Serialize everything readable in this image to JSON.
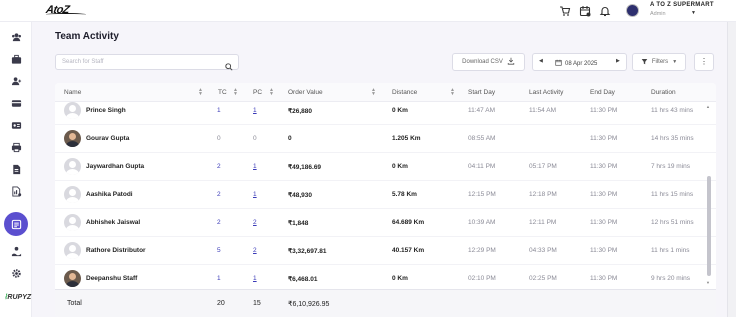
{
  "topbar": {
    "logo_text": "AtoZ",
    "store_name": "A TO Z SUPERMART",
    "user_role": "Admin",
    "icons": [
      "cart-icon",
      "calendar-check-icon",
      "bell-icon"
    ]
  },
  "sidebar": {
    "brand": "RUPYZ",
    "items": [
      "team-icon",
      "briefcase-icon",
      "user-add-icon",
      "card-icon",
      "id-card-icon",
      "print-icon",
      "document-icon",
      "chart-doc-icon",
      "team-activity-icon",
      "hand-user-icon",
      "settings-icon"
    ],
    "active_item": "team-activity-icon",
    "accent_color": "#5b4fcf"
  },
  "page": {
    "title": "Team Activity"
  },
  "toolbar": {
    "search_placeholder": "Search for Staff",
    "download_label": "Download CSV",
    "date": "08 Apr 2025",
    "filters_label": "Filters"
  },
  "table": {
    "columns": [
      "Name",
      "TC",
      "PC",
      "Order Value",
      "Distance",
      "Start Day",
      "Last Activity",
      "End Day",
      "Duration"
    ],
    "rows": [
      {
        "name": "Prince Singh",
        "tc": "1",
        "pc": "1",
        "order_value": "₹26,880",
        "distance": "0 Km",
        "start_day": "11:47 AM",
        "last_activity": "11:54 AM",
        "end_day": "11:30 PM",
        "duration": "11 hrs 43 mins",
        "photo": false
      },
      {
        "name": "Gourav Gupta",
        "tc": "0",
        "pc": "0",
        "order_value": "0",
        "distance": "1.205 Km",
        "start_day": "08:55 AM",
        "last_activity": "",
        "end_day": "11:30 PM",
        "duration": "14 hrs 35 mins",
        "photo": true
      },
      {
        "name": "Jaywardhan Gupta",
        "tc": "2",
        "pc": "1",
        "order_value": "₹49,186.69",
        "distance": "0 Km",
        "start_day": "04:11 PM",
        "last_activity": "05:17 PM",
        "end_day": "11:30 PM",
        "duration": "7 hrs 19 mins",
        "photo": false
      },
      {
        "name": "Aashika Patodi",
        "tc": "2",
        "pc": "1",
        "order_value": "₹48,930",
        "distance": "5.78 Km",
        "start_day": "12:15 PM",
        "last_activity": "12:18 PM",
        "end_day": "11:30 PM",
        "duration": "11 hrs 15 mins",
        "photo": false
      },
      {
        "name": "Abhishek Jaiswal",
        "tc": "2",
        "pc": "2",
        "order_value": "₹1,848",
        "distance": "64.689 Km",
        "start_day": "10:39 AM",
        "last_activity": "12:11 PM",
        "end_day": "11:30 PM",
        "duration": "12 hrs 51 mins",
        "photo": false
      },
      {
        "name": "Rathore Distributor",
        "tc": "5",
        "pc": "2",
        "order_value": "₹3,32,697.81",
        "distance": "40.157 Km",
        "start_day": "12:29 PM",
        "last_activity": "04:33 PM",
        "end_day": "11:30 PM",
        "duration": "11 hrs 1 mins",
        "photo": false
      },
      {
        "name": "Deepanshu Staff",
        "tc": "1",
        "pc": "1",
        "order_value": "₹6,468.01",
        "distance": "0 Km",
        "start_day": "02:10 PM",
        "last_activity": "02:25 PM",
        "end_day": "11:30 PM",
        "duration": "9 hrs 20 mins",
        "photo": true
      }
    ],
    "total": {
      "label": "Total",
      "tc": "20",
      "pc": "15",
      "order_value": "₹6,10,926.95"
    }
  }
}
